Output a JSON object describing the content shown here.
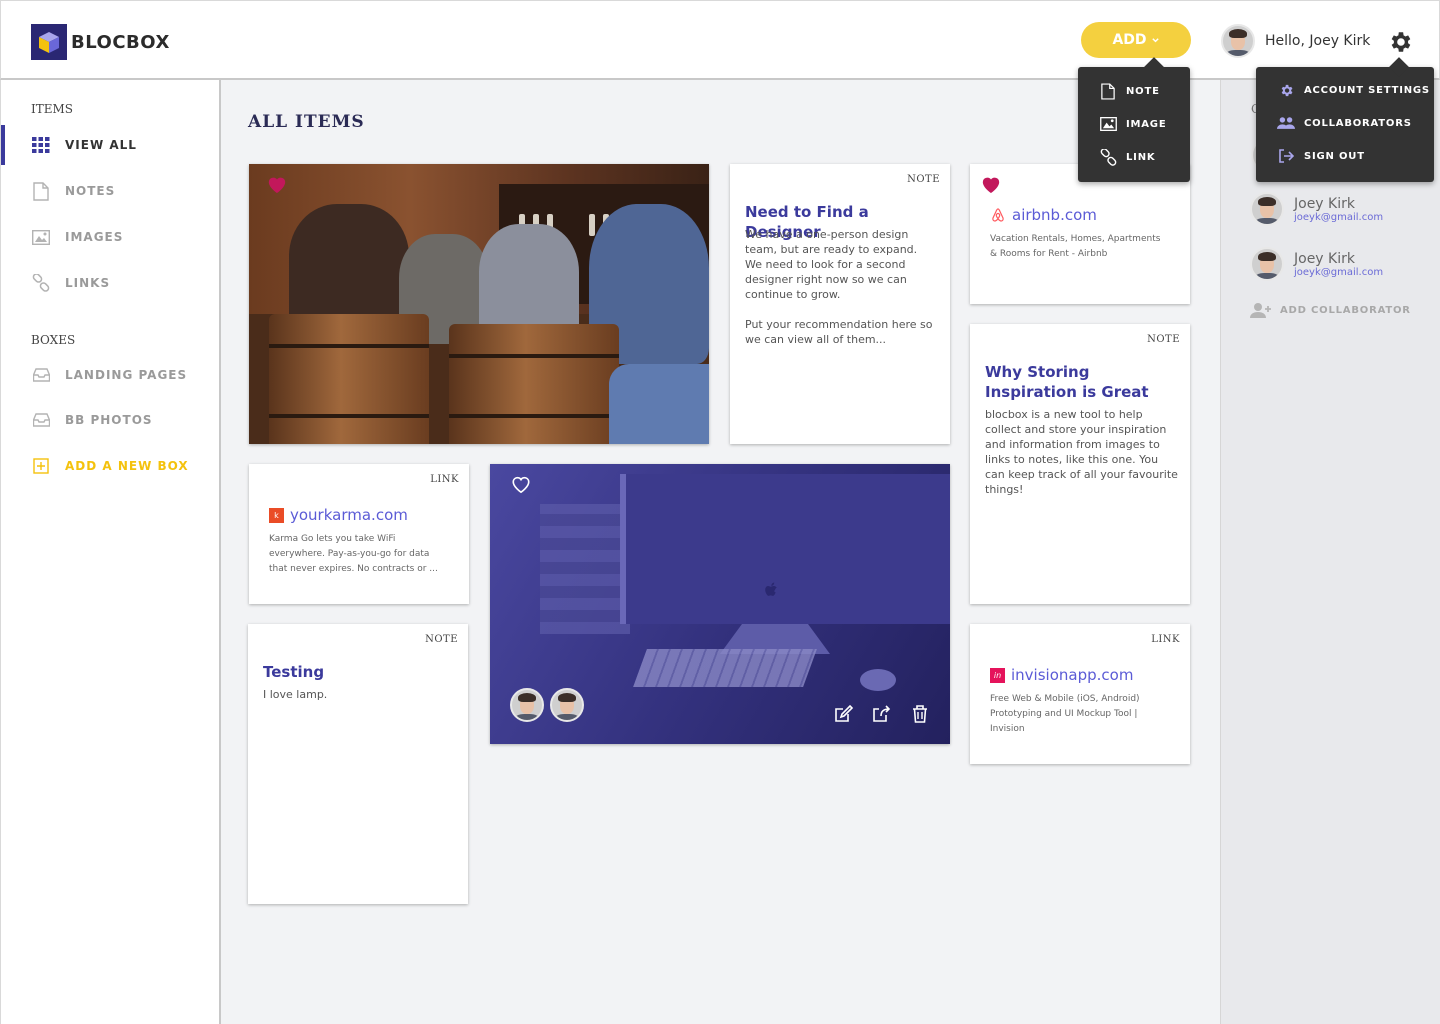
{
  "app": {
    "name": "BLOCBOX"
  },
  "header": {
    "add_label": "ADD",
    "greeting": "Hello, Joey Kirk"
  },
  "add_menu": {
    "items": [
      {
        "label": "NOTE",
        "icon": "note-icon"
      },
      {
        "label": "IMAGE",
        "icon": "image-icon"
      },
      {
        "label": "LINK",
        "icon": "link-icon"
      }
    ]
  },
  "settings_menu": {
    "items": [
      {
        "label": "ACCOUNT SETTINGS",
        "icon": "gear-icon"
      },
      {
        "label": "COLLABORATORS",
        "icon": "people-icon"
      },
      {
        "label": "SIGN OUT",
        "icon": "sign-out-icon"
      }
    ]
  },
  "sidebar": {
    "items_heading": "ITEMS",
    "items": [
      {
        "label": "VIEW ALL",
        "icon": "grid-icon",
        "active": true
      },
      {
        "label": "NOTES",
        "icon": "note-icon"
      },
      {
        "label": "IMAGES",
        "icon": "image-icon"
      },
      {
        "label": "LINKS",
        "icon": "link-icon"
      }
    ],
    "boxes_heading": "BOXES",
    "boxes": [
      {
        "label": "LANDING PAGES",
        "icon": "inbox-icon"
      },
      {
        "label": "BB PHOTOS",
        "icon": "inbox-icon"
      }
    ],
    "add_box": "ADD A NEW BOX"
  },
  "main": {
    "title": "ALL ITEMS",
    "cards": {
      "designer_note": {
        "type": "NOTE",
        "title": "Need to Find a Designer",
        "body_1": "We have a one-person design team, but are ready to expand. We need to look for a second designer right now so we can continue to grow.",
        "body_2": "Put your recommendation here so we can view all of them..."
      },
      "airbnb_link": {
        "type": "LINK",
        "url": "airbnb.com",
        "desc": "Vacation Rentals, Homes, Apartments & Rooms for Rent - Airbnb"
      },
      "inspiration_note": {
        "type": "NOTE",
        "title": "Why Storing Inspiration is Great",
        "body": "blocbox is a new tool to help collect and store your inspiration and information from images to links to notes, like this one. You can keep track of all your favourite things!"
      },
      "karma_link": {
        "type": "LINK",
        "url": "yourkarma.com",
        "desc": "Karma Go lets you take WiFi everywhere.  Pay-as-you-go for data that never expires. No contracts or ..."
      },
      "computer_image": {
        "type": "COMPUTER.JPG"
      },
      "testing_note": {
        "type": "NOTE",
        "title": "Testing",
        "body": "I love lamp."
      },
      "invision_link": {
        "type": "LINK",
        "url": "invisionapp.com",
        "desc": "Free Web & Mobile (iOS, Android) Prototyping and UI Mockup Tool | Invision"
      }
    }
  },
  "collaborators_panel": {
    "heading_partial": "C",
    "people": [
      {
        "name": "Joey Kirk",
        "email": "joeyk@gmail.com"
      },
      {
        "name": "Joey Kirk",
        "email": "joeyk@gmail.com"
      }
    ],
    "add_label": "ADD COLLABORATOR"
  },
  "colors": {
    "accent": "#3b3a9c",
    "yellow": "#f4d03f",
    "heart": "#c2185b",
    "link": "#5b5bd6"
  }
}
